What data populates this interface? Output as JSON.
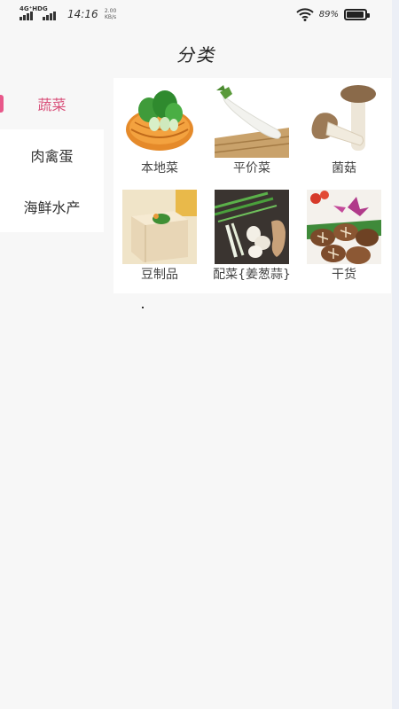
{
  "status_bar": {
    "network_1": "4G⁺HD",
    "network_2": "G",
    "time": "14:16",
    "speed": "2.00 KB/s",
    "battery": "89%"
  },
  "page": {
    "title": "分类"
  },
  "sidebar": {
    "items": [
      {
        "label": "蔬菜",
        "active": true
      },
      {
        "label": "肉禽蛋",
        "active": false
      },
      {
        "label": "海鲜水产",
        "active": false
      }
    ]
  },
  "grid": {
    "items": [
      {
        "label": "本地菜",
        "icon": "bok-choy-image"
      },
      {
        "label": "平价菜",
        "icon": "radish-image"
      },
      {
        "label": "菌菇",
        "icon": "mushroom-image"
      },
      {
        "label": "豆制品",
        "icon": "tofu-image"
      },
      {
        "label": "配菜{姜葱蒜}",
        "icon": "scallion-garlic-image"
      },
      {
        "label": "干货",
        "icon": "shiitake-image"
      }
    ]
  },
  "colors": {
    "accent": "#d9507a",
    "marker": "#e8588a",
    "background": "#f7f7f7"
  }
}
